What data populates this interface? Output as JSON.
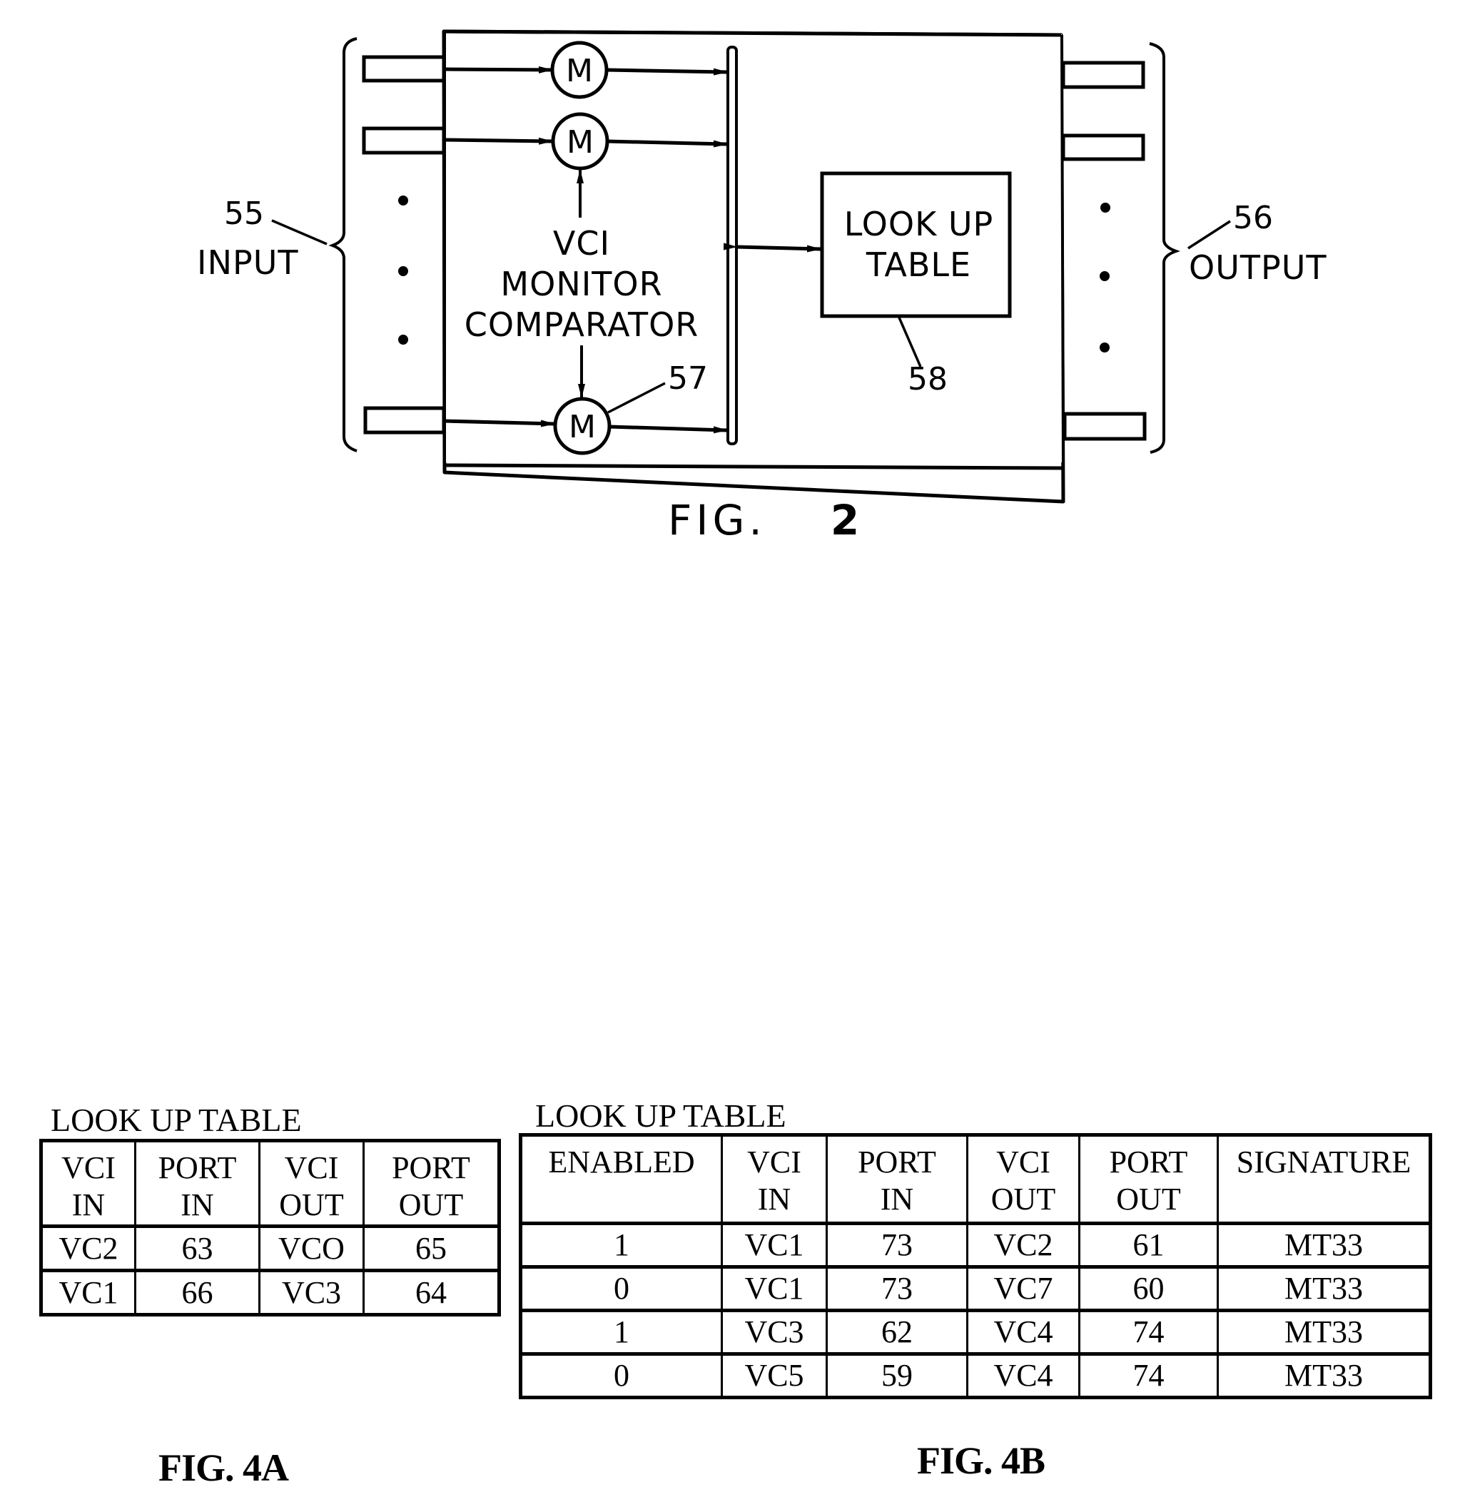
{
  "fig2": {
    "caption": "FIG.",
    "caption_number": "2",
    "input_label": "INPUT",
    "input_ref": "55",
    "output_label": "OUTPUT",
    "output_ref": "56",
    "monitor_ref": "57",
    "lookup_ref": "58",
    "monitor_symbol": "M",
    "vci_monitor_lines": [
      "VCI",
      "MONITOR",
      "COMPARATOR"
    ],
    "lookup_table_lines": [
      "LOOK UP",
      "TABLE"
    ],
    "monitor_count_visible": 3,
    "input_ports_visible": 3,
    "output_ports_visible": 3,
    "ellipsis_dots": 3
  },
  "fig4a": {
    "title": "LOOK UP TABLE",
    "caption": "FIG. 4A",
    "columns": [
      {
        "line1": "VCI",
        "line2": "IN"
      },
      {
        "line1": "PORT",
        "line2": "IN"
      },
      {
        "line1": "VCI",
        "line2": "OUT"
      },
      {
        "line1": "PORT",
        "line2": "OUT"
      }
    ],
    "rows": [
      [
        "VC2",
        "63",
        "VCO",
        "65"
      ],
      [
        "VC1",
        "66",
        "VC3",
        "64"
      ]
    ]
  },
  "fig4b": {
    "title": "LOOK UP TABLE",
    "caption": "FIG. 4B",
    "columns": [
      {
        "line1": "ENABLED",
        "line2": ""
      },
      {
        "line1": "VCI",
        "line2": "IN"
      },
      {
        "line1": "PORT",
        "line2": "IN"
      },
      {
        "line1": "VCI",
        "line2": "OUT"
      },
      {
        "line1": "PORT",
        "line2": "OUT"
      },
      {
        "line1": "SIGNATURE",
        "line2": ""
      }
    ],
    "rows": [
      [
        "1",
        "VC1",
        "73",
        "VC2",
        "61",
        "MT33"
      ],
      [
        "0",
        "VC1",
        "73",
        "VC7",
        "60",
        "MT33"
      ],
      [
        "1",
        "VC3",
        "62",
        "VC4",
        "74",
        "MT33"
      ],
      [
        "0",
        "VC5",
        "59",
        "VC4",
        "74",
        "MT33"
      ]
    ]
  }
}
